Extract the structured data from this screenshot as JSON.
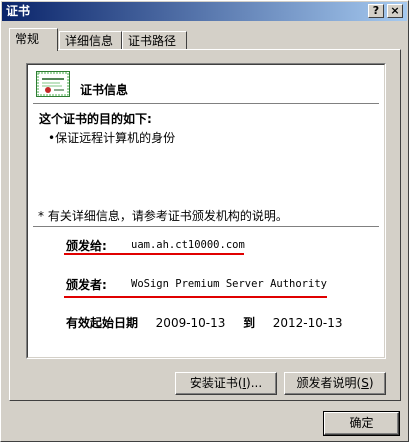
{
  "window": {
    "title": "证书",
    "help_button": "?",
    "close_button": "×"
  },
  "tabs": [
    {
      "label": "常规",
      "active": true
    },
    {
      "label": "详细信息",
      "active": false
    },
    {
      "label": "证书路径",
      "active": false
    }
  ],
  "certificate": {
    "header": "证书信息",
    "purpose_heading": "这个证书的目的如下:",
    "purposes": [
      "•保证远程计算机的身份"
    ],
    "note": "* 有关详细信息，请参考证书颁发机构的说明。",
    "issued_to_label": "颁发给:",
    "issued_to_value": "uam.ah.ct10000.com",
    "issued_by_label": "颁发者:",
    "issued_by_value": "WoSign Premium Server Authority",
    "valid_from_label": "有效起始日期",
    "valid_from": "2009-10-13",
    "valid_to_label": "到",
    "valid_to": "2012-10-13",
    "highlight_color": "#e00000"
  },
  "buttons": {
    "install_prefix": "安装证书(",
    "install_key": "I",
    "install_suffix": ")...",
    "statement_prefix": "颁发者说明(",
    "statement_key": "S",
    "statement_suffix": ")",
    "ok": "确定"
  }
}
